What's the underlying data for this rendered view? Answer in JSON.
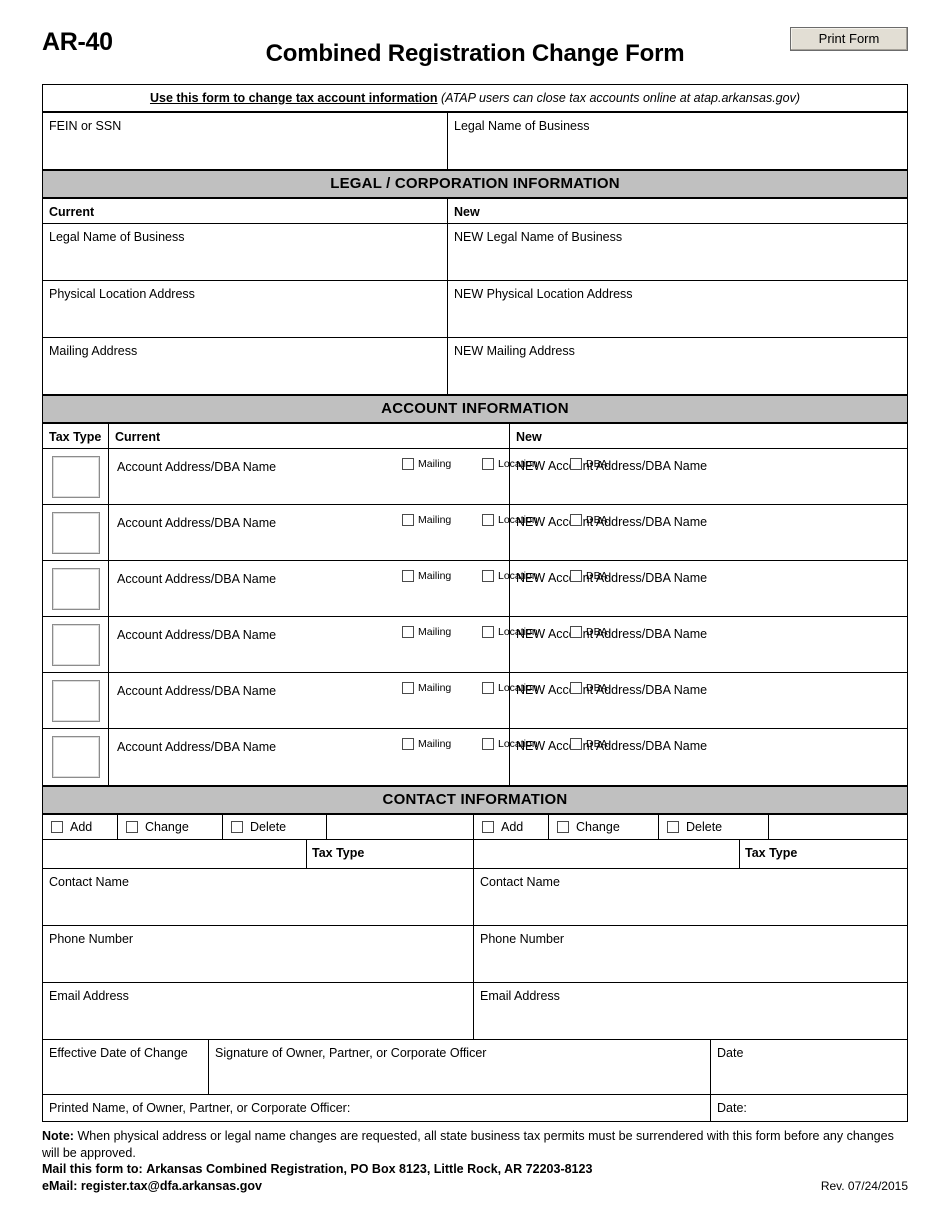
{
  "header": {
    "form_code": "AR-40",
    "title": "Combined Registration Change Form",
    "print_button": "Print Form"
  },
  "notice": {
    "underlined": "Use this form to change tax account information",
    "italic": "(ATAP users can close tax accounts online at atap.arkansas.gov)"
  },
  "identity": {
    "fein_label": "FEIN or SSN",
    "legal_name_label": "Legal Name of Business"
  },
  "legal_section": {
    "band_title": "LEGAL / CORPORATION INFORMATION",
    "col_current": "Current",
    "col_new": "New",
    "rows": [
      {
        "current": "Legal Name of Business",
        "new": "NEW Legal Name of Business"
      },
      {
        "current": "Physical Location Address",
        "new": "NEW Physical Location Address"
      },
      {
        "current": "Mailing Address",
        "new": "NEW Mailing Address"
      }
    ]
  },
  "account_section": {
    "band_title": "ACCOUNT INFORMATION",
    "col_tax_type": "Tax Type",
    "col_current": "Current",
    "col_new": "New",
    "row_current_label": "Account Address/DBA Name",
    "row_new_label": "NEW Account Address/DBA Name",
    "checkboxes": [
      "Mailing",
      "Location",
      "DBA"
    ],
    "row_count": 6
  },
  "contact_section": {
    "band_title": "CONTACT INFORMATION",
    "options": [
      "Add",
      "Change",
      "Delete"
    ],
    "tax_type_label": "Tax Type",
    "fields": [
      "Contact Name",
      "Phone Number",
      "Email Address"
    ]
  },
  "signature_section": {
    "effective_date": "Effective Date of Change",
    "signature": "Signature of Owner, Partner, or Corporate Officer",
    "date": "Date",
    "printed_name": "Printed Name, of Owner, Partner, or Corporate Officer:",
    "date_colon": "Date:"
  },
  "footer": {
    "note_label": "Note:",
    "note_text": "When physical address or legal name changes are requested, all state business tax permits must be surrendered with this form before any changes will be approved.",
    "mail_label": "Mail this form to:",
    "mail_text": "Arkansas Combined Registration, PO Box 8123, Little Rock, AR  72203-8123",
    "email_label": "eMail:",
    "email_text": "register.tax@dfa.arkansas.gov",
    "revision": "Rev. 07/24/2015"
  },
  "colors": {
    "band_gray": "#c0c0c0",
    "button_face": "#e2ded4",
    "rule": "#000000"
  }
}
